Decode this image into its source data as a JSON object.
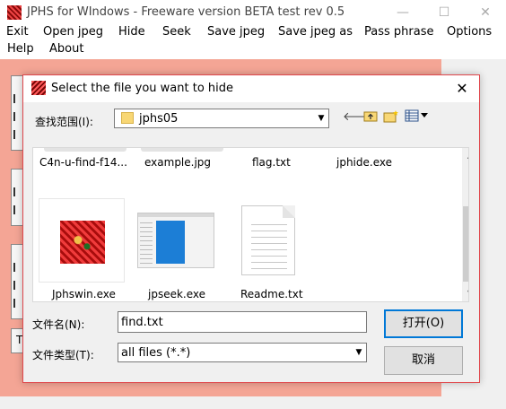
{
  "main_window": {
    "title": "JPHS for WIndows - Freeware version BETA test rev 0.5",
    "controls": {
      "minimize": "—",
      "maximize": "☐",
      "close": "✕"
    },
    "menu": [
      "Exit",
      "Open jpeg",
      "Hide",
      "Seek",
      "Save jpeg",
      "Save jpeg as",
      "Pass phrase",
      "Options",
      "Help",
      "About"
    ],
    "background_fragment_text": "T"
  },
  "dialog": {
    "title": "Select the file you want to hide",
    "close": "✕",
    "look_in_label": "查找范围(I):",
    "look_in_value": "jphs05",
    "toolbar": {
      "back_icon": "🡐",
      "up_folder_icon": "up-folder-icon",
      "new_folder_icon": "new-folder-icon",
      "view_menu_icon": "view-menu-icon"
    },
    "files_row1": [
      "C4n-u-find-f14...",
      "example.jpg",
      "flag.txt",
      "jphide.exe"
    ],
    "files_row2": [
      "Jphswin.exe",
      "jpseek.exe",
      "Readme.txt"
    ],
    "file_name_label": "文件名(N):",
    "file_name_value": "find.txt",
    "file_type_label": "文件类型(T):",
    "file_type_value": "all files (*.*)",
    "open_button": "打开(O)",
    "cancel_button": "取消"
  },
  "colors": {
    "main_client_bg": "#f4a595",
    "dialog_border": "#e0474c",
    "default_button_border": "#0078d7"
  }
}
